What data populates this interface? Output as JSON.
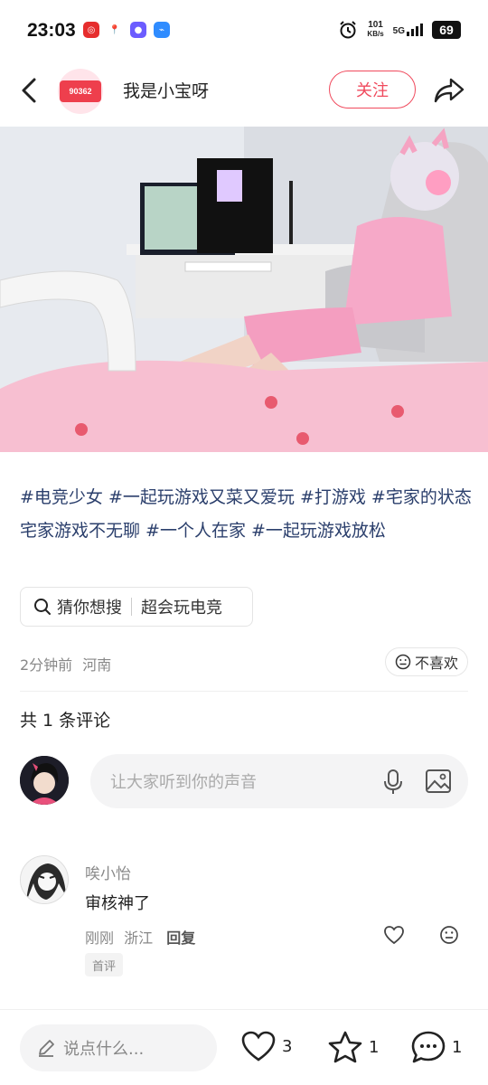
{
  "status_bar": {
    "time": "23:03",
    "speed_value": "101",
    "speed_unit": "KB/s",
    "network": "5G",
    "battery": "69"
  },
  "header": {
    "author_name": "我是小宝呀",
    "avatar_badge": "90362",
    "follow_label": "关注"
  },
  "post": {
    "caption_parts": [
      "#电竞少女 ",
      "#一起玩游戏又菜又爱玩 ",
      "#打游戏 ",
      "#宅家的状态 ",
      "宅家游戏不无聊 ",
      "#一个人在家 ",
      "#一起玩游戏放松"
    ],
    "search_prefix": "猜你想搜",
    "search_term": "超会玩电竞",
    "time_ago": "2分钟前",
    "location": "河南",
    "dislike_label": "不喜欢"
  },
  "comments": {
    "count_label": "共 1 条评论",
    "input_placeholder": "让大家听到你的声音",
    "items": [
      {
        "user": "唉小怡",
        "text": "审核神了",
        "time": "刚刚",
        "location": "浙江",
        "reply_label": "回复",
        "tag": "首评"
      }
    ]
  },
  "bottom_bar": {
    "say_placeholder": "说点什么...",
    "likes": "3",
    "favorites": "1",
    "comments": "1"
  },
  "colors": {
    "accent": "#f04a5d",
    "hashtag": "#2b3f6c"
  }
}
